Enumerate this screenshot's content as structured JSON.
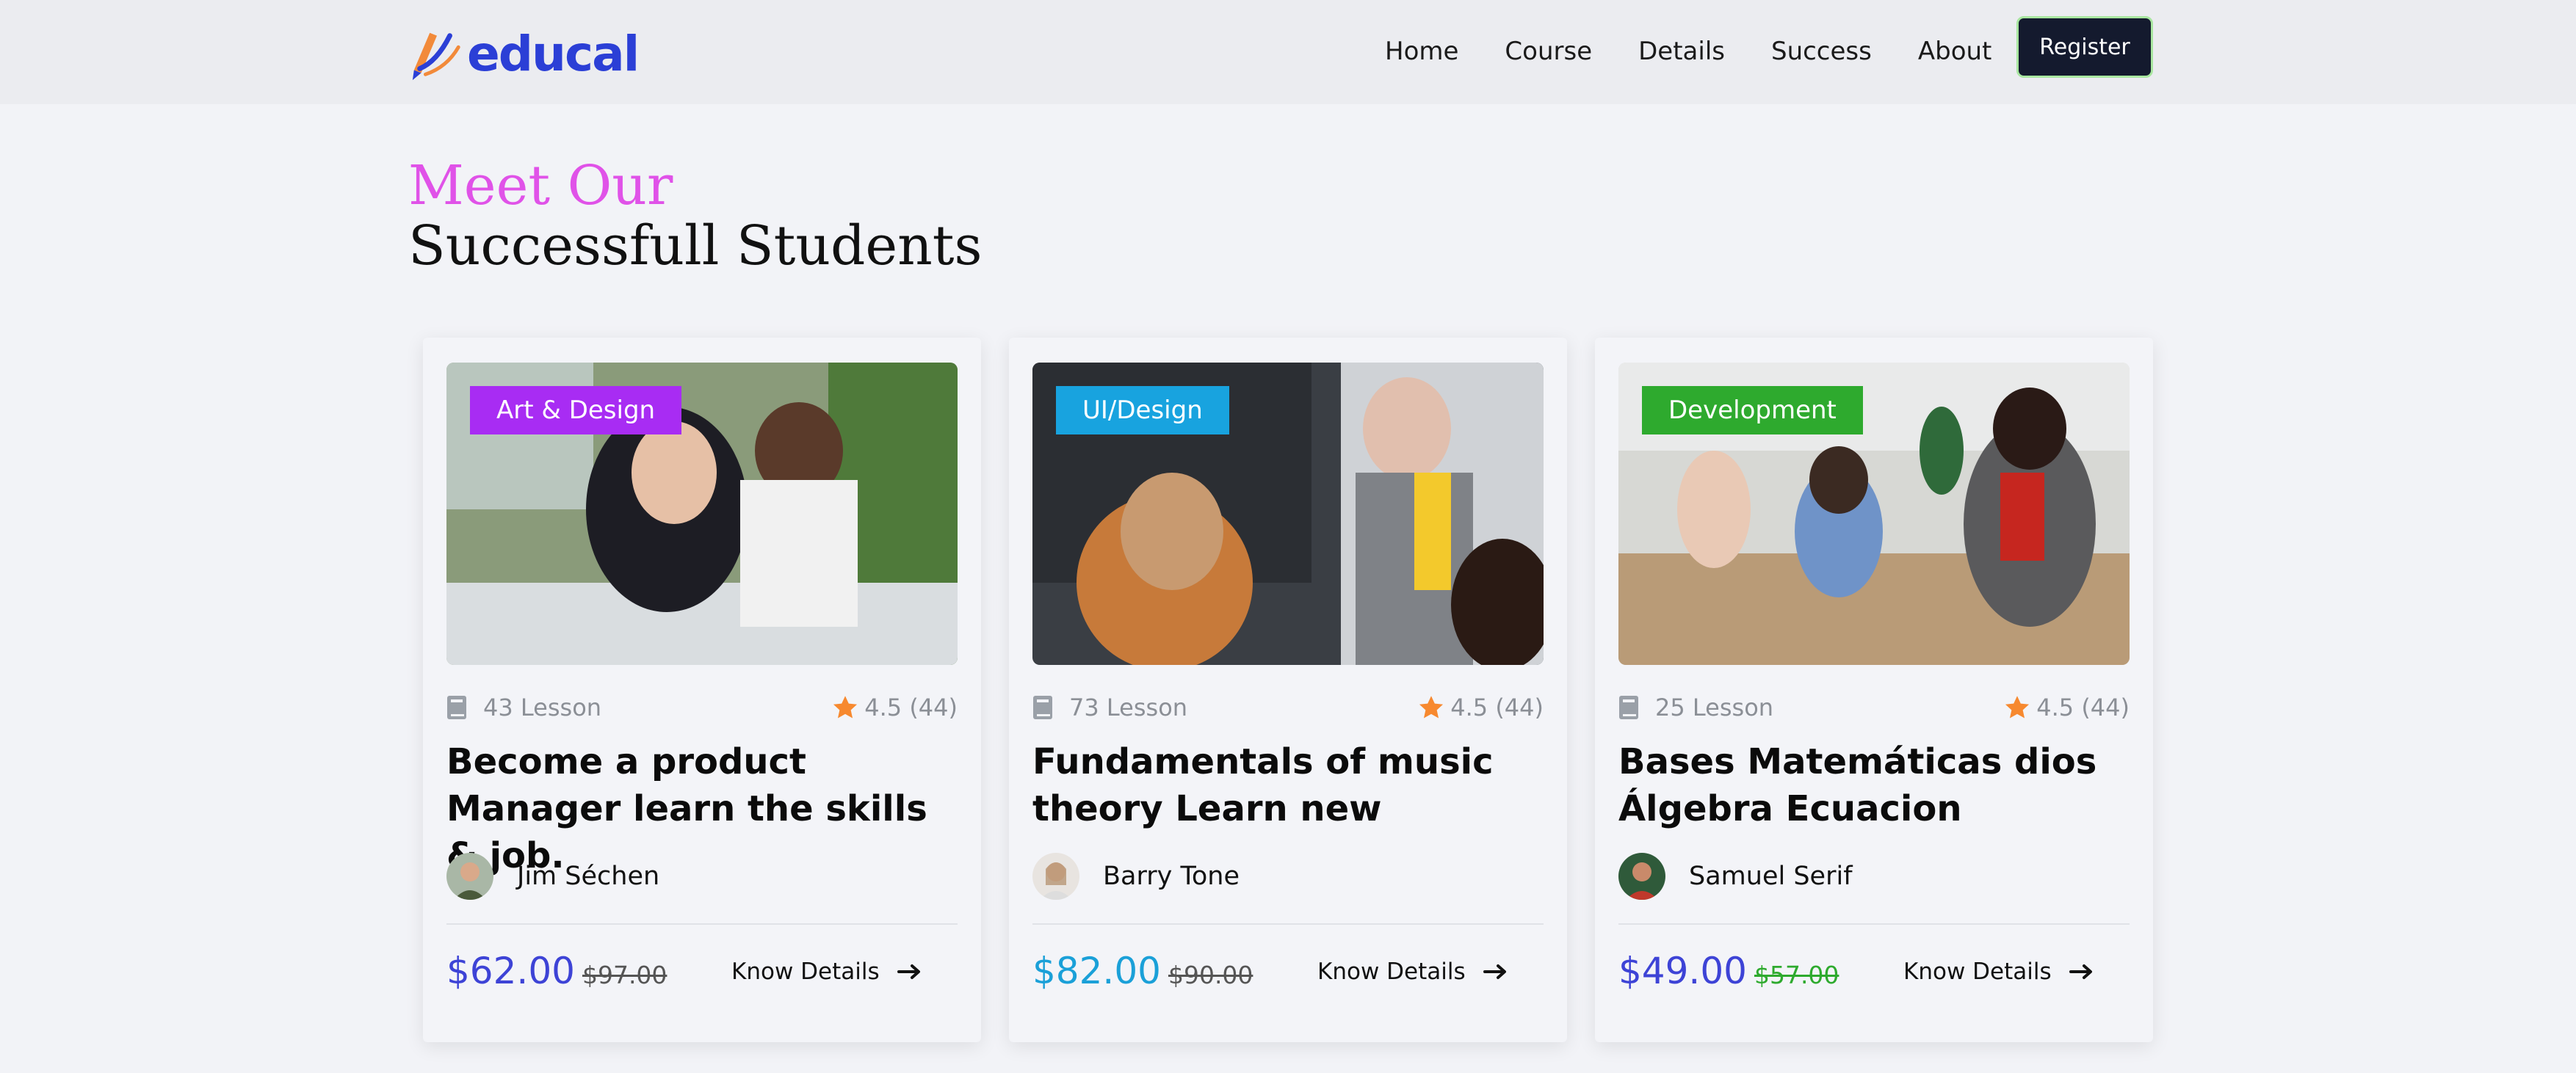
{
  "header": {
    "logo_text": "educal",
    "logo_color": "#2b3fd6",
    "nav": [
      "Home",
      "Course",
      "Details",
      "Success",
      "About"
    ],
    "register_label": "Register"
  },
  "section": {
    "heading_line1": "Meet Our",
    "heading_line2": "Successfull Students",
    "heading_line1_color": "#e052e8"
  },
  "cards": [
    {
      "category": "Art & Design",
      "category_color": "#a82cf3",
      "lessons": "43 Lesson",
      "rating": "4.5 (44)",
      "title": "Become a product Manager learn the skills & job.",
      "instructor": "Jim Séchen",
      "price": "$62.00",
      "old_price": "$97.00",
      "price_color": "#3d43d6",
      "old_price_color": "#555555",
      "link": "Know Details"
    },
    {
      "category": "UI/Design",
      "category_color": "#18a3df",
      "lessons": "73 Lesson",
      "rating": "4.5 (44)",
      "title": "Fundamentals of music theory Learn new",
      "instructor": "Barry Tone",
      "price": "$82.00",
      "old_price": "$90.00",
      "price_color": "#1aa0d8",
      "old_price_color": "#555555",
      "link": "Know Details"
    },
    {
      "category": "Development",
      "category_color": "#2eaa2e",
      "lessons": "25 Lesson",
      "rating": "4.5 (44)",
      "title": "Bases Matemáticas dios Álgebra Ecuacion",
      "instructor": "Samuel Serif",
      "price": "$49.00",
      "old_price": "$57.00",
      "price_color": "#3d43d6",
      "old_price_color": "#2eaa2e",
      "link": "Know Details"
    }
  ]
}
